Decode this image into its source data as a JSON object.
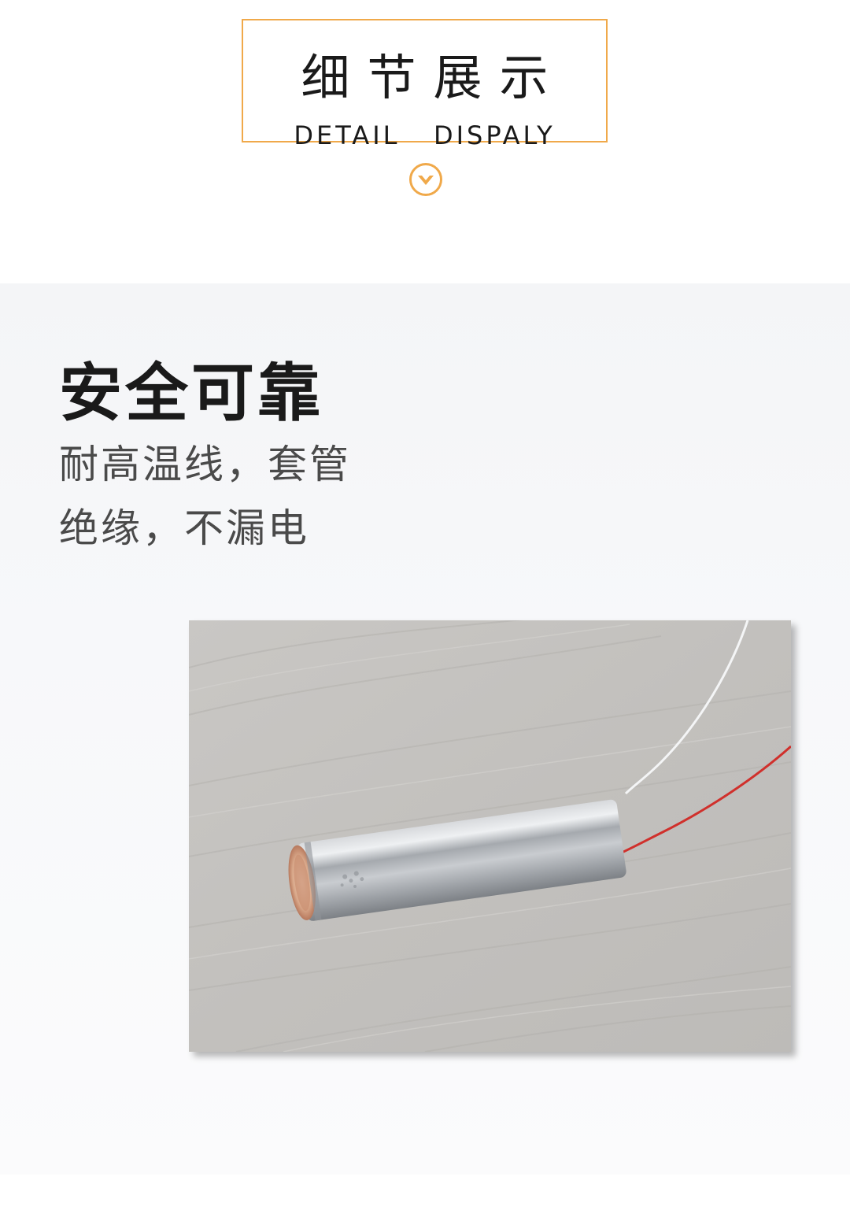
{
  "header": {
    "title_cn": "细节展示",
    "title_en": "DETAIL   DISPALY",
    "accent_color": "#f0a94a",
    "scroll_icon": "chevron-down-circle-icon"
  },
  "feature": {
    "title": "安全可靠",
    "lines": [
      "耐高温线，套管",
      "绝缘，不漏电"
    ]
  },
  "photo": {
    "subject": "product-photo"
  }
}
